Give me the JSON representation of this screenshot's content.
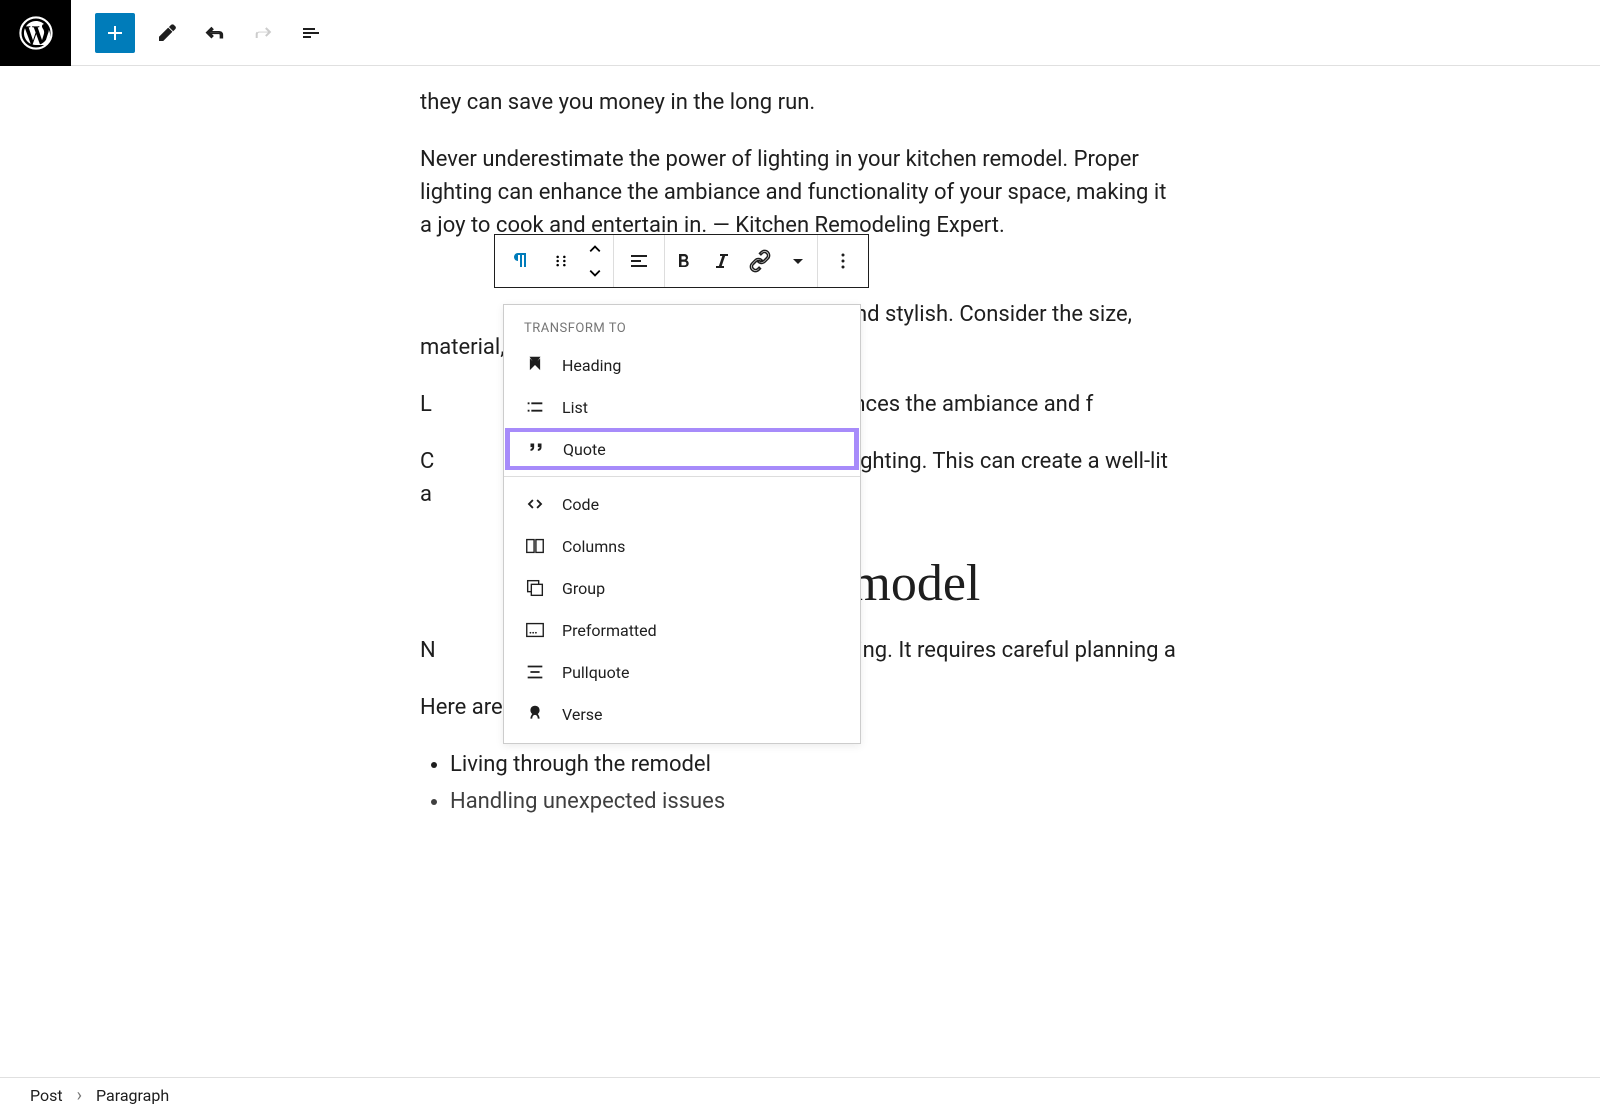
{
  "toolbar": {
    "add_label": "Add block",
    "tools_label": "Tools",
    "undo_label": "Undo",
    "redo_label": "Redo",
    "outline_label": "Document outline"
  },
  "content": {
    "paragraph1": "they can save you money in the long run.",
    "paragraph2": "Never underestimate the power of lighting in your kitchen remodel. Proper lighting can enhance the ambiance and functionality of your space, making it a joy to cook and entertain in. — Kitchen Remodeling Expert.",
    "paragraph3_visible": "nd stylish. Consider the size, material,",
    "paragraph4_start": "L",
    "paragraph4_end": "nhances the ambiance and f",
    "paragraph5_start": "C",
    "paragraph5_end": "ccent lighting. This can create a well-lit a",
    "heading_visible_right": "the Remodel",
    "paragraph6_start": "N",
    "paragraph6_end": "allenging. It requires careful planning a",
    "paragraph7": "Here are some key aspects to consider:",
    "list_items": [
      "Living through the remodel",
      "Handling unexpected issues"
    ]
  },
  "block_toolbar": {
    "paragraph_label": "Paragraph",
    "drag_label": "Drag",
    "move_up_label": "Move up",
    "move_down_label": "Move down",
    "align_label": "Align",
    "bold_label": "Bold",
    "italic_label": "Italic",
    "link_label": "Link",
    "more_rich_label": "More rich text controls",
    "options_label": "Options"
  },
  "transform_menu": {
    "header": "TRANSFORM TO",
    "items": [
      {
        "label": "Heading",
        "icon": "heading"
      },
      {
        "label": "List",
        "icon": "list"
      },
      {
        "label": "Quote",
        "icon": "quote",
        "highlighted": true
      },
      {
        "label": "Code",
        "icon": "code"
      },
      {
        "label": "Columns",
        "icon": "columns"
      },
      {
        "label": "Group",
        "icon": "group"
      },
      {
        "label": "Preformatted",
        "icon": "preformatted"
      },
      {
        "label": "Pullquote",
        "icon": "pullquote"
      },
      {
        "label": "Verse",
        "icon": "verse"
      }
    ]
  },
  "breadcrumb": {
    "root": "Post",
    "current": "Paragraph"
  }
}
